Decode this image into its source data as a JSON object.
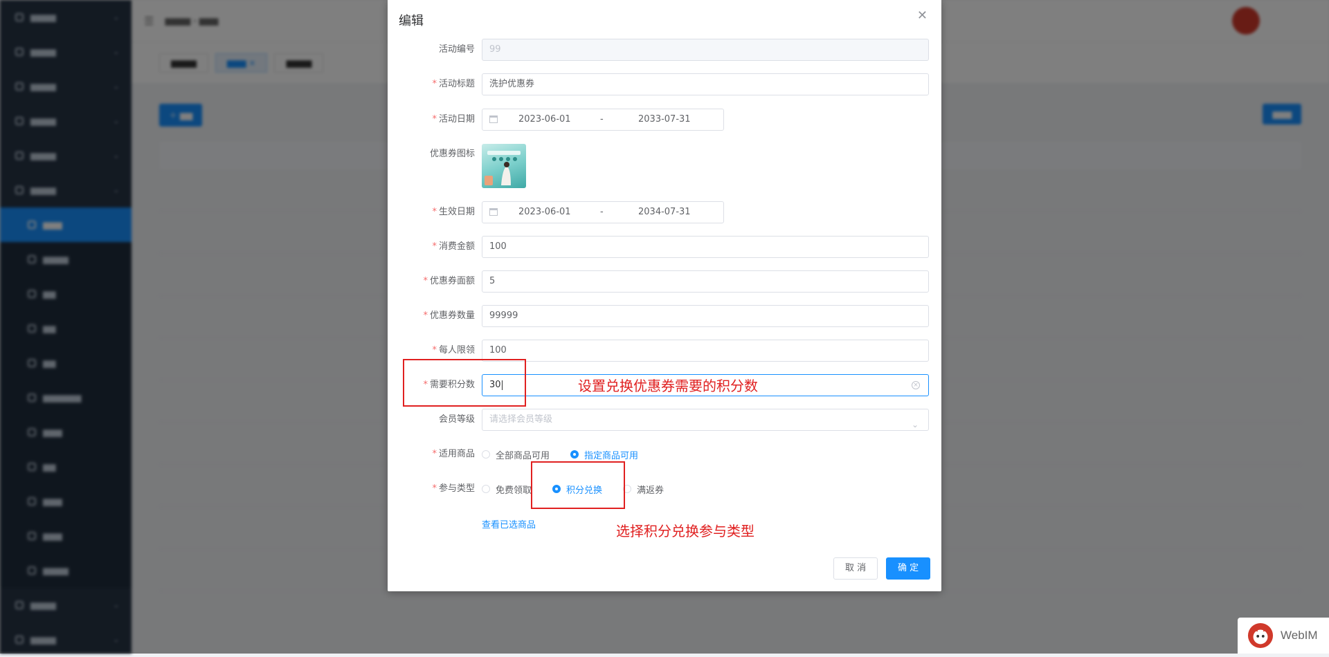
{
  "dialog": {
    "title": "编辑",
    "close_icon": "close-icon",
    "fields": {
      "activity_no": {
        "label": "活动编号",
        "value": "99"
      },
      "activity_title": {
        "label": "活动标题",
        "value": "洗护优惠券"
      },
      "activity_date": {
        "label": "活动日期",
        "start": "2023-06-01",
        "separator": "-",
        "end": "2033-07-31"
      },
      "coupon_icon": {
        "label": "优惠券图标"
      },
      "effective_date": {
        "label": "生效日期",
        "start": "2023-06-01",
        "separator": "-",
        "end": "2034-07-31"
      },
      "spend_amount": {
        "label": "消费金额",
        "value": "100"
      },
      "coupon_value": {
        "label": "优惠券面额",
        "value": "5"
      },
      "coupon_count": {
        "label": "优惠券数量",
        "value": "99999"
      },
      "per_person_limit": {
        "label": "每人限领",
        "value": "100"
      },
      "points_required": {
        "label": "需要积分数",
        "value": "30"
      },
      "member_level": {
        "label": "会员等级",
        "placeholder": "请选择会员等级"
      },
      "applicable_goods": {
        "label": "适用商品",
        "options": [
          "全部商品可用",
          "指定商品可用"
        ],
        "selected": "指定商品可用"
      },
      "participation_type": {
        "label": "参与类型",
        "options": [
          "免费领取",
          "积分兑换",
          "满返券"
        ],
        "selected": "积分兑换"
      }
    },
    "view_selected_goods": "查看已选商品",
    "cancel_label": "取 消",
    "confirm_label": "确 定"
  },
  "annotations": {
    "points_note": "设置兑换优惠券需要的积分数",
    "type_note": "选择积分兑换参与类型",
    "color": "#e02020"
  },
  "watermark": {
    "text": "WebIM"
  },
  "colors": {
    "primary": "#1890ff",
    "sidebar": "#263445",
    "required": "#f56c6c"
  }
}
